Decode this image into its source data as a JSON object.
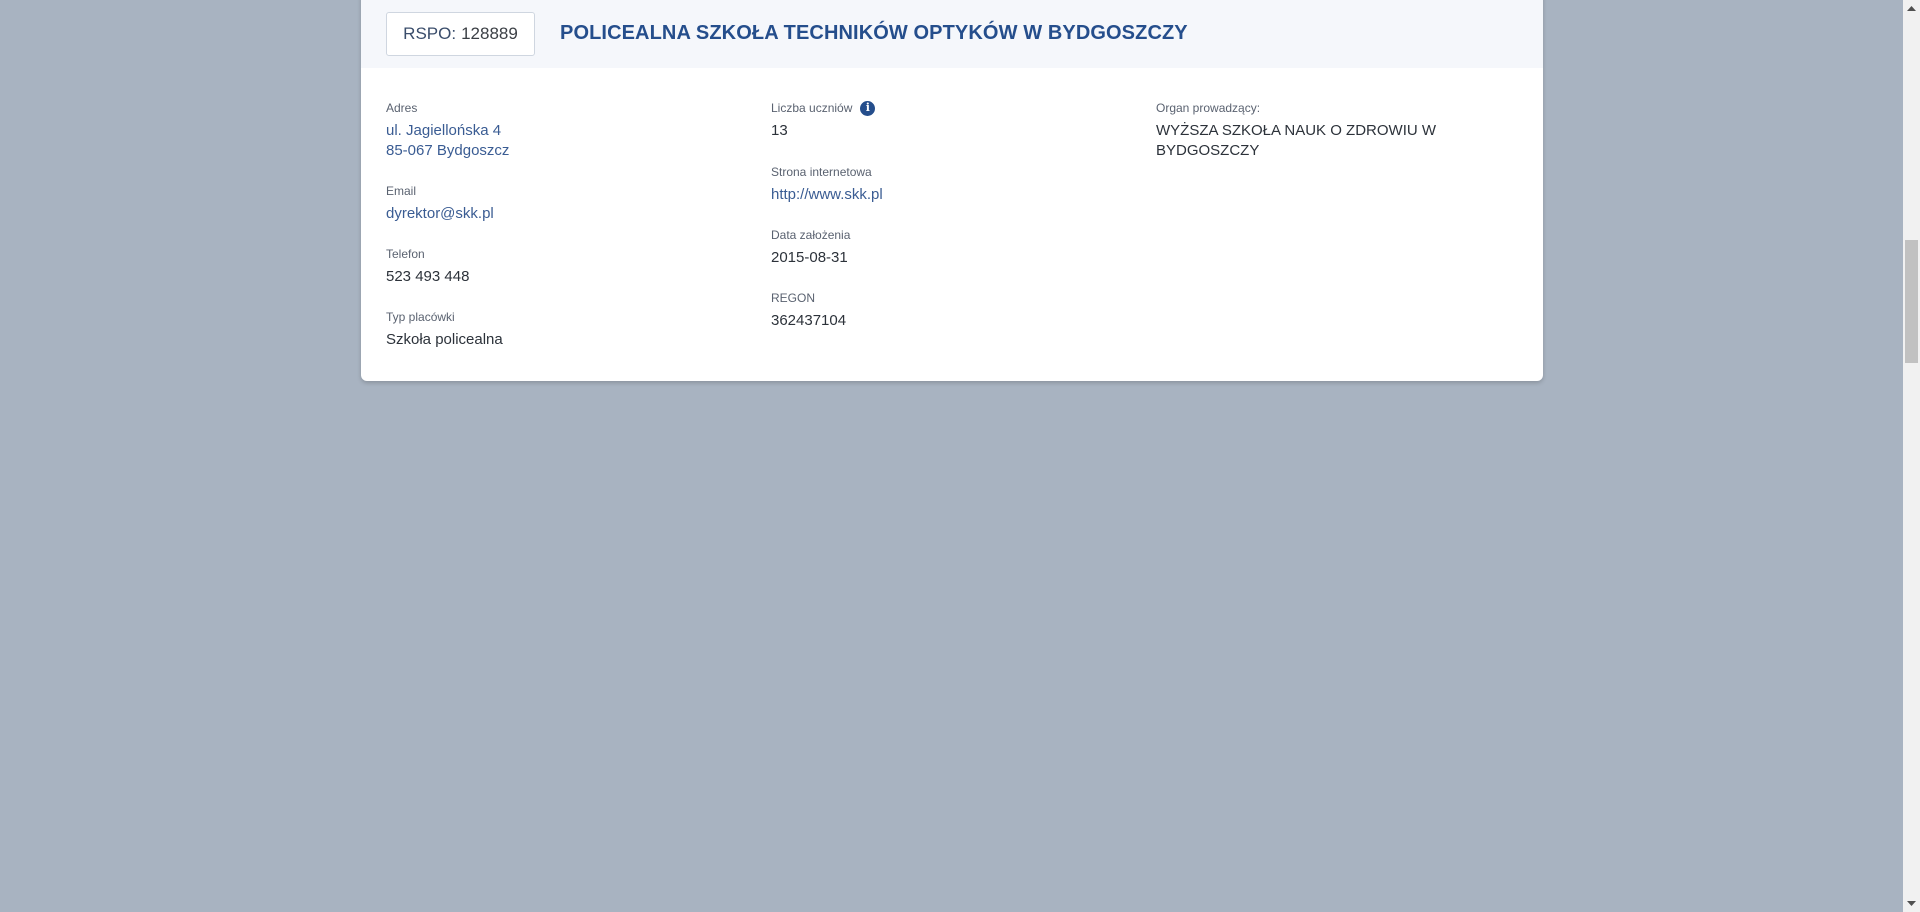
{
  "header": {
    "rspo_prefix": "RSPO:",
    "rspo_number": "128889",
    "school_name": "POLICEALNA SZKOŁA TECHNIKÓW OPTYKÓW W BYDGOSZCZY"
  },
  "column1": {
    "address_label": "Adres",
    "address_line1": "ul. Jagiellońska 4",
    "address_line2": "85-067 Bydgoszcz",
    "email_label": "Email",
    "email_value": "dyrektor@skk.pl",
    "phone_label": "Telefon",
    "phone_value": "523 493 448",
    "type_label": "Typ placówki",
    "type_value": "Szkoła policealna"
  },
  "column2": {
    "students_label": "Liczba uczniów",
    "students_value": "13",
    "website_label": "Strona internetowa",
    "website_value": "http://www.skk.pl",
    "founded_label": "Data założenia",
    "founded_value": "2015-08-31",
    "regon_label": "REGON",
    "regon_value": "362437104"
  },
  "column3": {
    "organ_label": "Organ prowadzący:",
    "organ_value": "WYŻSZA SZKOŁA NAUK O ZDROWIU W BYDGOSZCZY"
  },
  "icons": {
    "info_icon": "info-icon",
    "info_glyph": "i"
  },
  "colors": {
    "background": "#a8b3c1",
    "accent": "#254e8c",
    "link": "#3a5c93"
  }
}
